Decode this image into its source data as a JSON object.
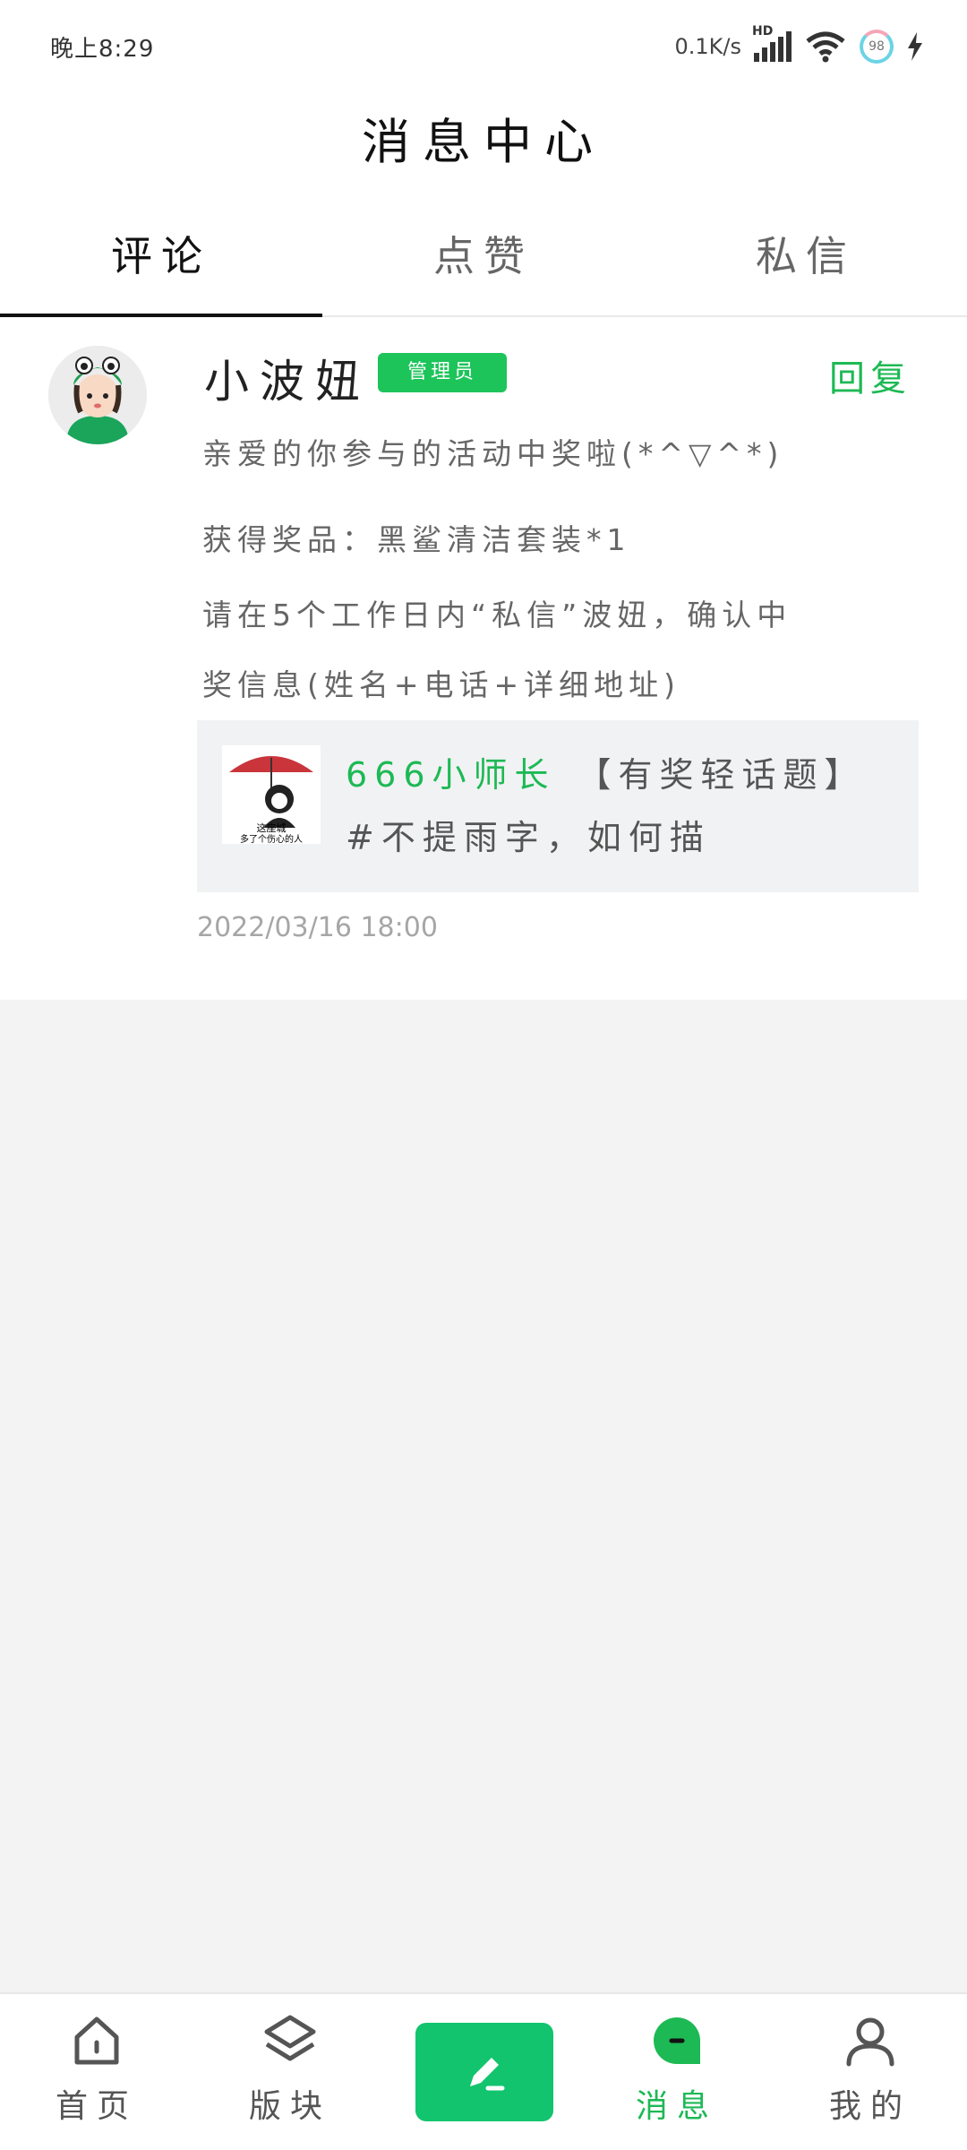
{
  "status_bar": {
    "time": "晚上8:29",
    "net_speed": "0.1K/s",
    "network_label": "HD",
    "battery": "98"
  },
  "header": {
    "title": "消息中心"
  },
  "tabs": [
    {
      "label": "评论",
      "active": true
    },
    {
      "label": "点赞",
      "active": false
    },
    {
      "label": "私信",
      "active": false
    }
  ],
  "comment": {
    "user": "小波妞",
    "badge": "管理员",
    "reply_label": "回复",
    "lines": [
      "亲爱的你参与的活动中奖啦(*^▽^*)",
      "获得奖品：黑鲨清洁套装*1",
      "请在5个工作日内“私信”波妞，确认中",
      "奖信息(姓名+电话+详细地址)"
    ],
    "quote": {
      "user": "666小师长",
      "text": "【有奖轻话题】#不提雨字，如何描",
      "thumb_caption_1": "这座城",
      "thumb_caption_2": "多了个伤心的人"
    },
    "timestamp": "2022/03/16  18:00"
  },
  "bottom_nav": {
    "home": "首页",
    "board": "版块",
    "messages": "消息",
    "me": "我的"
  },
  "colors": {
    "accent": "#1db954",
    "badge": "#1cc45a",
    "post_button": "#12c46d",
    "background": "#f3f3f4"
  }
}
